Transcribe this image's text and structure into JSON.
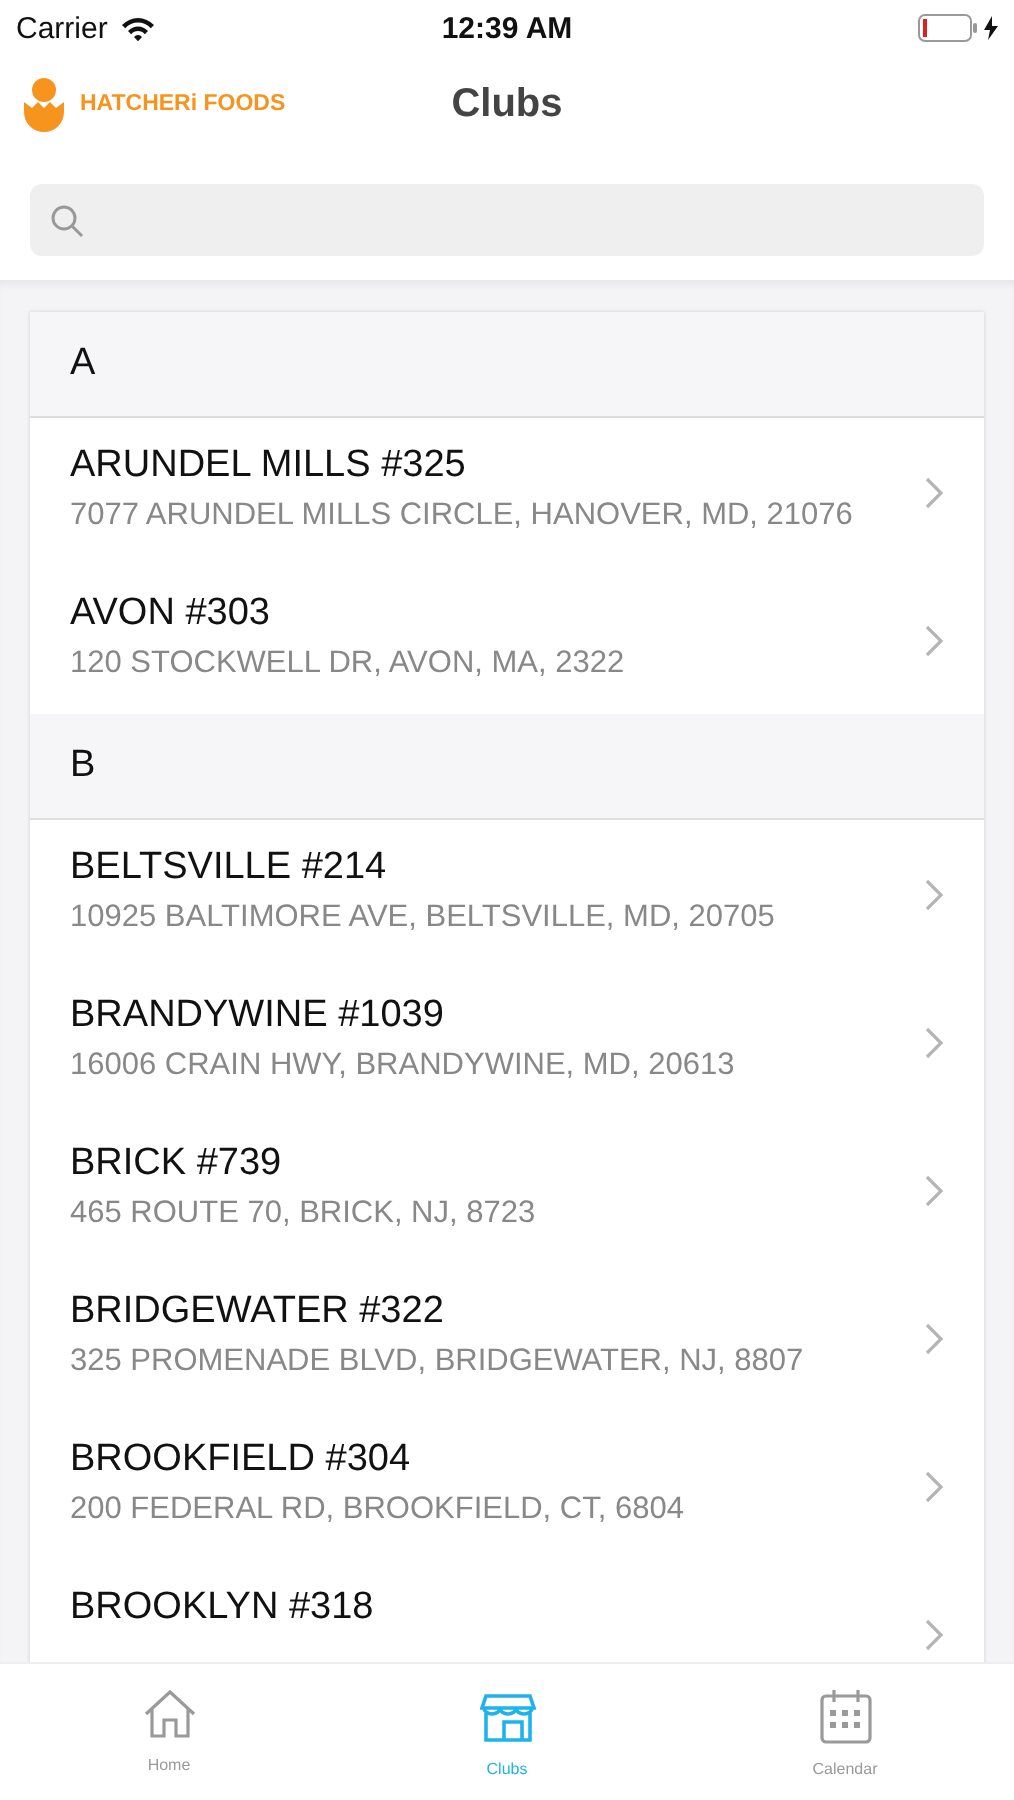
{
  "status_bar": {
    "carrier": "Carrier",
    "time": "12:39 AM",
    "battery_charging": true
  },
  "nav": {
    "logo_text": "HATCHERi FOODS",
    "title": "Clubs"
  },
  "sections": [
    {
      "letter": "A",
      "clubs": [
        {
          "name": "ARUNDEL MILLS #325",
          "address": "7077 ARUNDEL MILLS CIRCLE, HANOVER, MD, 21076"
        },
        {
          "name": "AVON #303",
          "address": "120 STOCKWELL DR, AVON, MA, 2322"
        }
      ]
    },
    {
      "letter": "B",
      "clubs": [
        {
          "name": "BELTSVILLE #214",
          "address": "10925 BALTIMORE AVE, BELTSVILLE, MD, 20705"
        },
        {
          "name": "BRANDYWINE #1039",
          "address": "16006 CRAIN HWY, BRANDYWINE, MD, 20613"
        },
        {
          "name": "BRICK #739",
          "address": "465 ROUTE 70, BRICK, NJ, 8723"
        },
        {
          "name": "BRIDGEWATER #322",
          "address": "325 PROMENADE BLVD, BRIDGEWATER, NJ, 8807"
        },
        {
          "name": "BROOKFIELD #304",
          "address": "200 FEDERAL RD, BROOKFIELD, CT, 6804"
        },
        {
          "name": "BROOKLYN #318"
        }
      ]
    }
  ],
  "tabs": [
    {
      "kind": "home",
      "label": "Home",
      "selected": false
    },
    {
      "kind": "store",
      "label": "Clubs",
      "selected": true
    },
    {
      "kind": "calendar",
      "label": "Calendar",
      "selected": false
    }
  ]
}
